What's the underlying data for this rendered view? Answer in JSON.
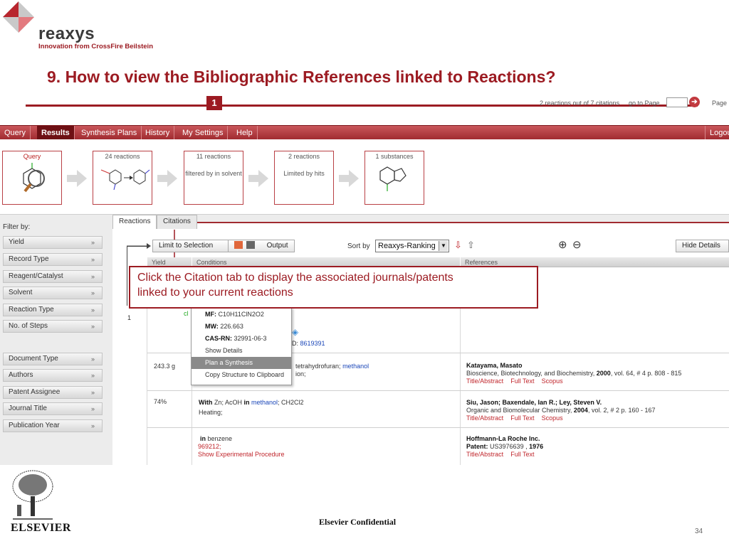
{
  "brand": {
    "name": "reaxys",
    "tagline": "Innovation from CrossFire Beilstein",
    "accent": "#9c1b22"
  },
  "slide": {
    "title": "9. How to view the Bibliographic References linked to Reactions?",
    "footer": "Elsevier Confidential",
    "number": "34",
    "publisher": "ELSEVIER"
  },
  "nav": {
    "tabs": [
      "Query",
      "Results",
      "Synthesis Plans",
      "History",
      "My Settings",
      "Help"
    ],
    "active": "Results",
    "logout": "Logou"
  },
  "steps": [
    {
      "title": "Query",
      "sub": ""
    },
    {
      "title": "24 reactions",
      "sub": ""
    },
    {
      "title": "11 reactions",
      "sub": "filtered by in solvent"
    },
    {
      "title": "2 reactions",
      "sub": "Limited by hits"
    },
    {
      "title": "1 substances",
      "sub": ""
    }
  ],
  "filters": {
    "label": "Filter by:",
    "group1": [
      "Yield",
      "Record Type",
      "Reagent/Catalyst",
      "Solvent",
      "Reaction Type",
      "No. of Steps"
    ],
    "group2": [
      "Document Type",
      "Authors",
      "Patent Assignee",
      "Journal Title",
      "Publication Year"
    ],
    "chevron": "»"
  },
  "tabs": {
    "reactions": "Reactions",
    "citations": "Citations"
  },
  "badge": "1",
  "meta": {
    "count": "2 reactions out of 7 citations",
    "goto": "go to Page",
    "page": "Page"
  },
  "toolbar": {
    "limit": "Limit to Selection",
    "output": "Output",
    "sort_label": "Sort by",
    "sort_value": "Reaxys-Ranking",
    "hide": "Hide Details"
  },
  "columns": {
    "yield": "Yield",
    "conditions": "Conditions",
    "references": "References"
  },
  "row1": {
    "index": "1",
    "id_prefix": "D:",
    "id_value": "8619391"
  },
  "popup": {
    "mf_label": "MF:",
    "mf": "C10H11ClN2O2",
    "mw_label": "MW:",
    "mw": "226.663",
    "cas_label": "CAS-RN:",
    "cas": "32991-06-3",
    "show": "Show Details",
    "plan": "Plan a Synthesis",
    "copy": "Copy Structure to Clipboard"
  },
  "row2": {
    "yield": "243.3 g",
    "cond_a": "tetrahydrofuran;",
    "cond_b": "methanol",
    "cond_c": "ion;",
    "author": "Katayama, Masato",
    "journal": "Bioscience, Biotechnology, and Biochemistry,",
    "year": "2000",
    "vol": ", vol. 64, # 4 p. 808 - 815",
    "l1": "Title/Abstract",
    "l2": "Full Text",
    "l3": "Scopus"
  },
  "row3": {
    "yield": "74%",
    "with": "With",
    "zn": "Zn; AcOH",
    "in": "in",
    "methanol": "methanol",
    "ch2cl2": "; CH2Cl2",
    "heating": "Heating;",
    "author": "Siu, Jason; Baxendale, Ian R.; Ley, Steven V.",
    "journal": "Organic and Biomolecular Chemistry,",
    "year": "2004",
    "vol": ", vol. 2, # 2 p. 160 - 167",
    "l1": "Title/Abstract",
    "l2": "Full Text",
    "l3": "Scopus"
  },
  "row4": {
    "in": "in",
    "solvent": "benzene",
    "code": "969212;",
    "link": "Show Experimental Procedure",
    "author": "Hoffmann-La Roche Inc.",
    "patent_label": "Patent:",
    "patent": "US3976639",
    "year": "1976",
    "l1": "Title/Abstract",
    "l2": "Full Text"
  },
  "callout": {
    "line1": "Click the Citation tab to display the associated journals/patents",
    "line2": "linked to your current reactions"
  }
}
